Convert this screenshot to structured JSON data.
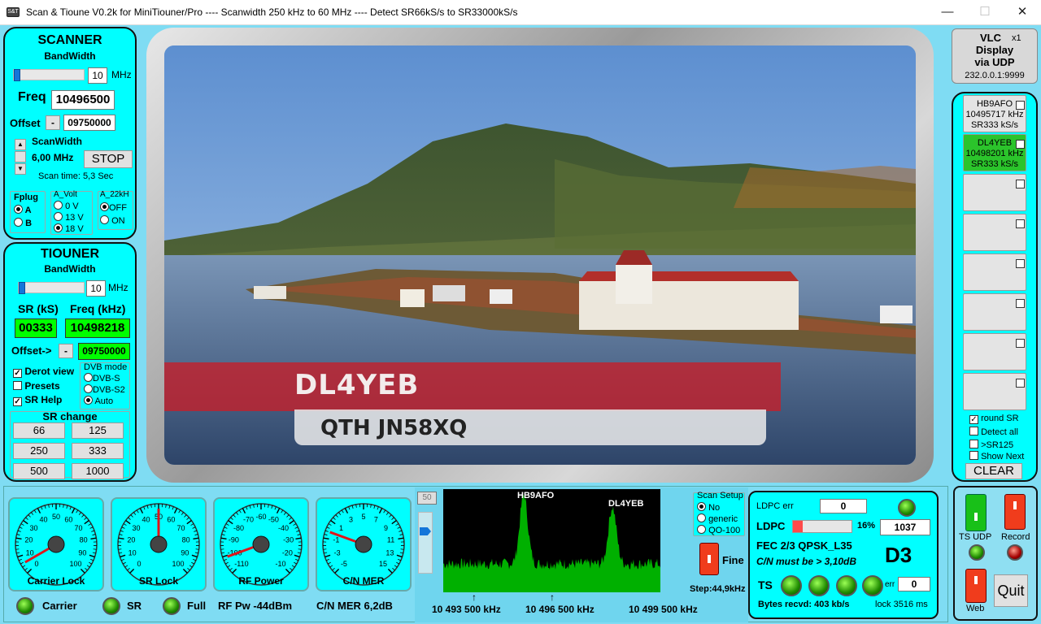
{
  "window": {
    "title": "Scan & Tioune V0.2k for MiniTiouner/Pro ---- Scanwidth 250 kHz to 60 MHz ---- Detect SR66kS/s to SR33000kS/s",
    "minimize": "—",
    "maximize": "☐",
    "close": "✕"
  },
  "scanner": {
    "title": "SCANNER",
    "bw_label": "BandWidth",
    "bw_value": "10",
    "bw_unit": "MHz",
    "bw_fraction": 0.0,
    "freq_label": "Freq",
    "freq_value": "10496500",
    "offset_label": "Offset",
    "offset_sign": "-",
    "offset_value": "09750000",
    "scanwidth_label": "ScanWidth",
    "scanwidth_value": "6,00 MHz",
    "stop_label": "STOP",
    "scantime_label": "Scan time:",
    "scantime_value": "5,3 Sec",
    "fplug_label": "Fplug",
    "fplug_options": [
      "A",
      "B"
    ],
    "avolt_label": "A_Volt",
    "avolt_options": [
      "0 V",
      "13 V",
      "18 V"
    ],
    "a22_label": "A_22kH",
    "a22_options": [
      "OFF",
      "ON"
    ]
  },
  "tiouner": {
    "title": "TIOUNER",
    "bw_label": "BandWidth",
    "bw_value": "10",
    "bw_unit": "MHz",
    "bw_fraction": 0.0,
    "sr_label": "SR (kS)",
    "freq_label": "Freq (kHz)",
    "sr_value": "00333",
    "freq_value": "10498218",
    "offset_label": "Offset->",
    "offset_sign": "-",
    "offset_value": "09750000",
    "derot_label": "Derot view",
    "presets_label": "Presets",
    "srhelp_label": "SR Help",
    "dvbmode_label": "DVB mode",
    "dvb_options": [
      "DVB-S",
      "DVB-S2",
      "Auto"
    ],
    "srchange_label": "SR change",
    "sr_buttons": [
      "66",
      "125",
      "250",
      "333",
      "500",
      "1000"
    ]
  },
  "video": {
    "callsign": "DL4YEB",
    "qth": "QTH JN58XQ"
  },
  "vlc": {
    "line1": "VLC",
    "x1": "x1",
    "line2": "Display",
    "line3": "via UDP",
    "address": "232.0.0.1:9999"
  },
  "stations": [
    {
      "call": "HB9AFO",
      "freq": "10495717 kHz",
      "sr": "SR333 kS/s"
    },
    {
      "call": "DL4YEB",
      "freq": "10498201 kHz",
      "sr": "SR333 kS/s"
    }
  ],
  "options": {
    "round_sr": "round SR",
    "detect_all": "Detect all",
    "sr125": ">SR125",
    "show_next": "Show Next",
    "clear": "CLEAR"
  },
  "gauges": [
    {
      "label": "Carrier Lock",
      "ticks": [
        "0",
        "10",
        "20",
        "30",
        "40",
        "50",
        "60",
        "70",
        "80",
        "90",
        "100"
      ]
    },
    {
      "label": "SR Lock",
      "ticks": [
        "0",
        "10",
        "20",
        "30",
        "40",
        "50",
        "60",
        "70",
        "80",
        "90",
        "100"
      ]
    },
    {
      "label": "RF Power",
      "ticks": [
        "-110",
        "-100",
        "-90",
        "-80",
        "-70",
        "-60",
        "-50",
        "-40",
        "-30",
        "-20",
        "-10"
      ]
    },
    {
      "label": "C/N MER",
      "ticks": [
        "-5",
        "-3",
        "-1",
        "1",
        "3",
        "5",
        "7",
        "9",
        "11",
        "13",
        "15"
      ]
    }
  ],
  "status": {
    "carrier": "Carrier",
    "sr": "SR",
    "full": "Full",
    "rfpw": "RF Pw  -44dBm",
    "cnmer": "C/N MER 6,2dB"
  },
  "spectrum": {
    "level": "50",
    "label1": "HB9AFO",
    "label2": "DL4YEB",
    "f1": "10 493 500 kHz",
    "f2": "10 496 500 kHz",
    "f3": "10 499 500 kHz"
  },
  "scansetup": {
    "label": "Scan Setup",
    "options": [
      "No",
      "generic",
      "QO-100"
    ],
    "fine": "Fine",
    "step": "Step:44,9kHz"
  },
  "decoder": {
    "ldpc_err_label": "LDPC err",
    "ldpc_err_value": "0",
    "ldpc_label": "LDPC",
    "ldpc_pct": "16%",
    "ldpc_count": "1037",
    "ldpc_fraction": 0.16,
    "fec": "FEC  2/3 QPSK_L35",
    "cn_must": "C/N must be > 3,10dB",
    "d3": "D3",
    "ts_label": "TS",
    "err_label": "err",
    "err_value": "0",
    "bytes": "Bytes recvd: 403 kb/s",
    "lock": "lock  3516 ms"
  },
  "right": {
    "ts_udp": "TS UDP",
    "record": "Record",
    "web": "Web",
    "quit": "Quit"
  },
  "colors": {
    "panel": "#00ffff",
    "background": "#7fdcf3",
    "led_green": "#1e8a00",
    "spectrum": "#00b000"
  }
}
